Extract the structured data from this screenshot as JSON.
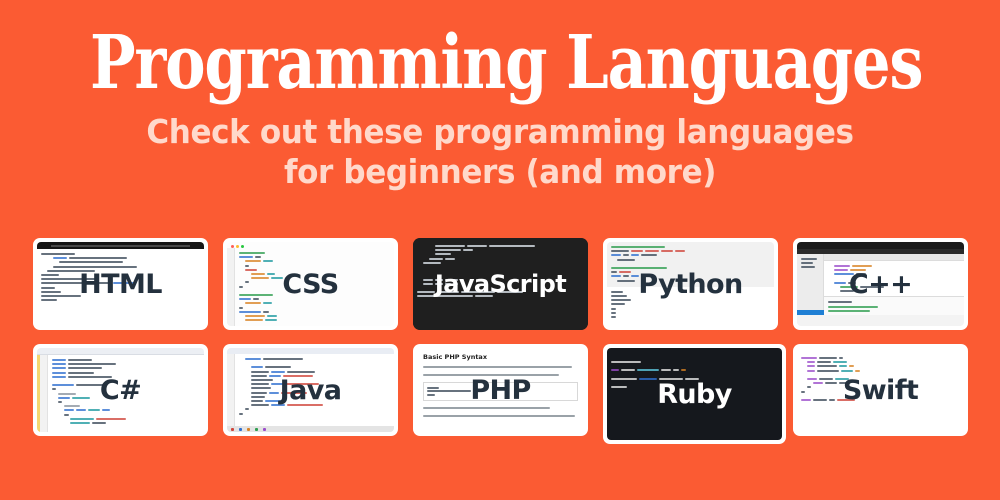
{
  "theme": {
    "background": "#FB5B33",
    "title_color": "#FFFFFF",
    "subtitle_color": "#FFD9CB",
    "label_dark": "#24313E",
    "label_light": "#FFFFFF"
  },
  "header": {
    "title": "Programming Languages",
    "subtitle_line1": "Check out these programming languages",
    "subtitle_line2": "for beginners (and more)"
  },
  "cards": [
    {
      "id": "html",
      "label": "HTML",
      "label_style": "dark",
      "thumbnail": "browser-window-with-html-source-code",
      "chrome": "dark-titlebar-white-page"
    },
    {
      "id": "css",
      "label": "CSS",
      "label_style": "dark",
      "thumbnail": "code-editor-with-css-rules",
      "chrome": "mac-traffic-lights-light-editor"
    },
    {
      "id": "javascript",
      "label": "JavaScript",
      "label_style": "light",
      "thumbnail": "dark-terminal-with-javascript-code",
      "chrome": "full-bleed-dark"
    },
    {
      "id": "python",
      "label": "Python",
      "label_style": "dark",
      "thumbnail": "python-script-with-console-output",
      "chrome": "grey-code-pane-over-white-output"
    },
    {
      "id": "cpp",
      "label": "C++",
      "label_style": "dark",
      "thumbnail": "vs-code-ide-with-cpp-project",
      "chrome": "ide-with-blue-status-bar"
    },
    {
      "id": "csharp",
      "label": "C#",
      "label_style": "dark",
      "thumbnail": "visual-studio-with-csharp-console-app",
      "chrome": "light-ide-with-toolbar"
    },
    {
      "id": "java",
      "label": "Java",
      "label_style": "dark",
      "thumbnail": "java-editor-with-line-numbers",
      "chrome": "light-ide-with-status-bar"
    },
    {
      "id": "php",
      "label": "PHP",
      "label_style": "dark",
      "thumbnail": "php-documentation-article",
      "chrome": "white-document-page"
    },
    {
      "id": "ruby",
      "label": "Ruby",
      "label_style": "light",
      "thumbnail": "dark-terminal-with-ruby-code",
      "chrome": "dark-code-pane"
    },
    {
      "id": "swift",
      "label": "Swift",
      "label_style": "dark",
      "thumbnail": "swift-struct-source-code",
      "chrome": "white-editor"
    }
  ],
  "php_doc": {
    "heading": "Basic PHP Syntax"
  }
}
